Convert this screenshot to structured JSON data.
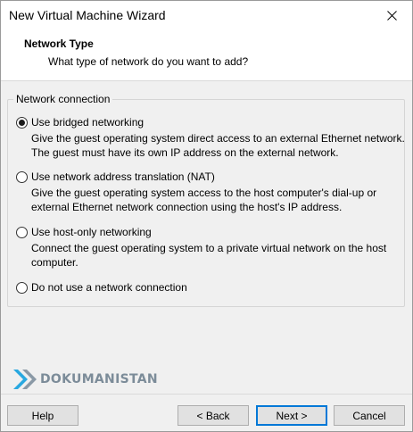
{
  "window": {
    "title": "New Virtual Machine Wizard",
    "close_icon": "close-icon"
  },
  "header": {
    "title": "Network Type",
    "subtitle": "What type of network do you want to add?"
  },
  "group": {
    "label": "Network connection",
    "options": [
      {
        "label": "Use bridged networking",
        "selected": true,
        "description": "Give the guest operating system direct access to an external Ethernet network. The guest must have its own IP address on the external network."
      },
      {
        "label": "Use network address translation (NAT)",
        "selected": false,
        "description": "Give the guest operating system access to the host computer's dial-up or external Ethernet network connection using the host's IP address."
      },
      {
        "label": "Use host-only networking",
        "selected": false,
        "description": "Connect the guest operating system to a private virtual network on the host computer."
      },
      {
        "label": "Do not use a network connection",
        "selected": false,
        "description": ""
      }
    ]
  },
  "watermark": {
    "text": "DOKUMANISTAN"
  },
  "buttons": {
    "help": "Help",
    "back": "< Back",
    "next": "Next >",
    "cancel": "Cancel"
  }
}
